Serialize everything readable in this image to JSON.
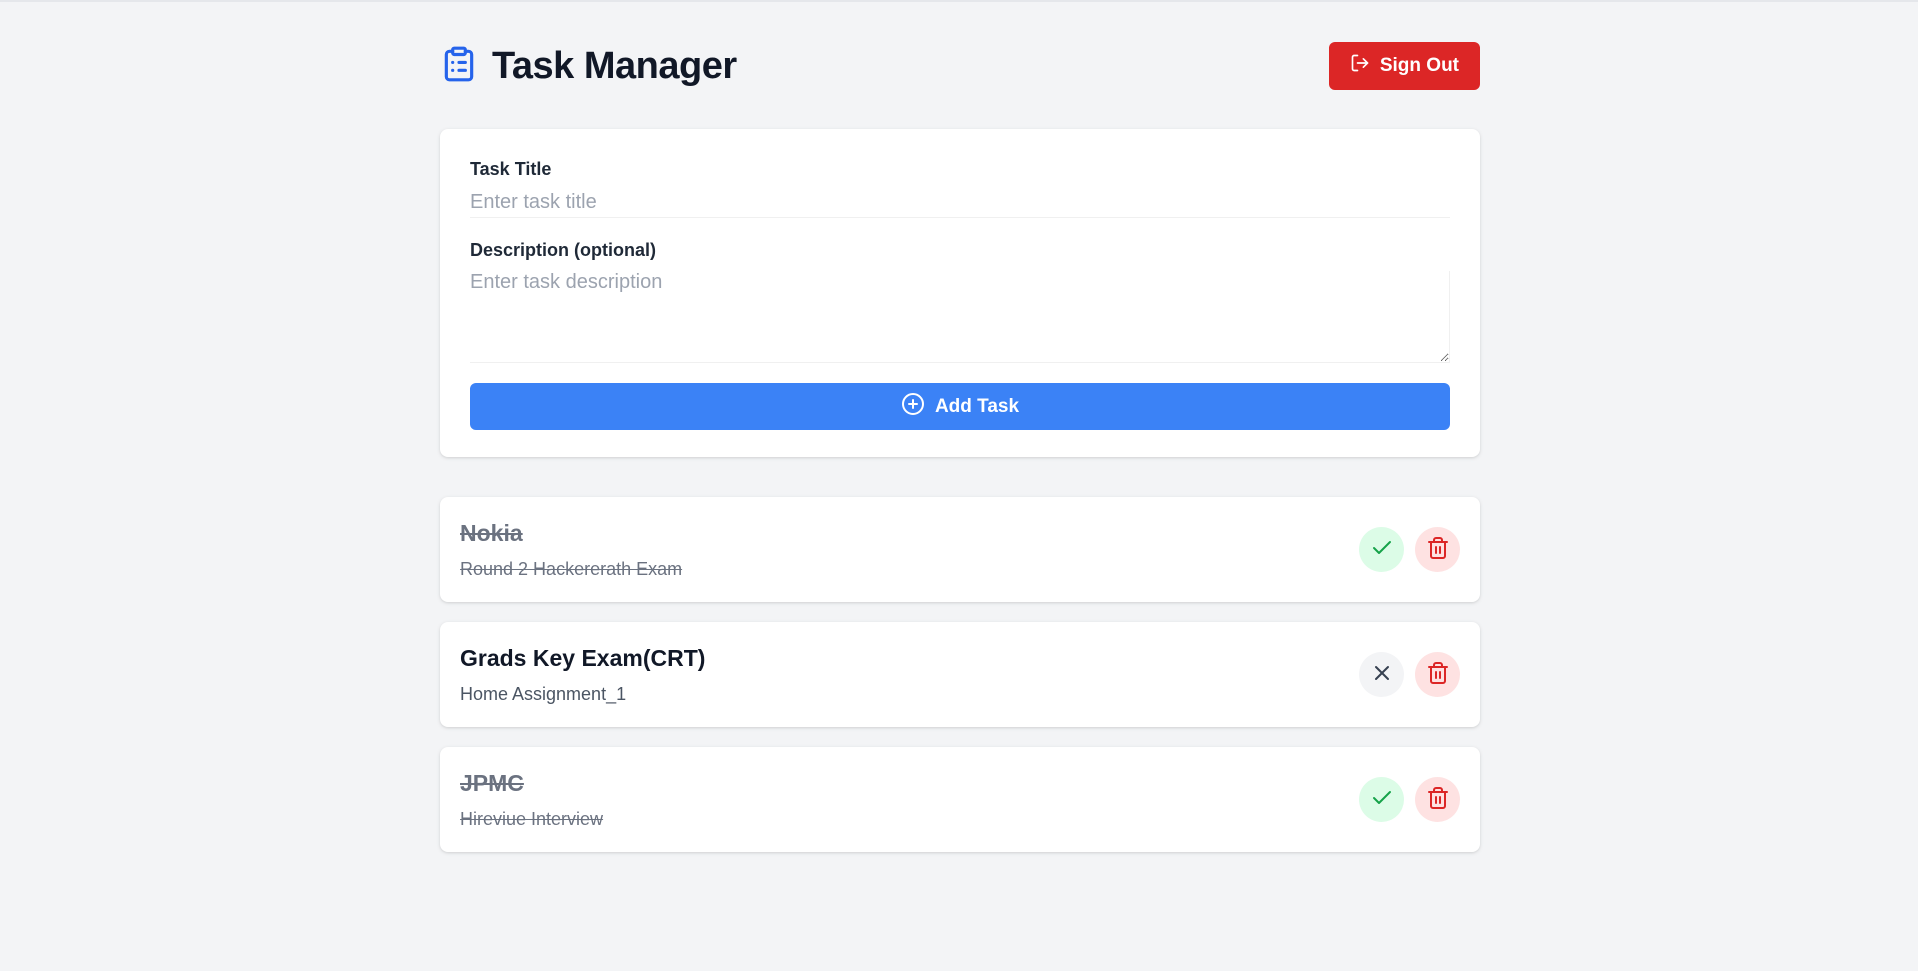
{
  "header": {
    "title": "Task Manager",
    "signout_label": "Sign Out",
    "icon": "clipboard-list-icon"
  },
  "form": {
    "title_label": "Task Title",
    "title_placeholder": "Enter task title",
    "title_value": "",
    "description_label": "Description (optional)",
    "description_placeholder": "Enter task description",
    "description_value": "",
    "add_label": "Add Task"
  },
  "tasks": [
    {
      "title": "Nokia",
      "description": "Round 2 Hackererath Exam",
      "completed": true
    },
    {
      "title": "Grads Key Exam(CRT)",
      "description": "Home Assignment_1",
      "completed": false
    },
    {
      "title": "JPMC",
      "description": "Hireviue Interview",
      "completed": true
    }
  ],
  "colors": {
    "background": "#f3f4f6",
    "primary": "#3b82f6",
    "danger": "#dc2626",
    "success": "#16a34a"
  }
}
